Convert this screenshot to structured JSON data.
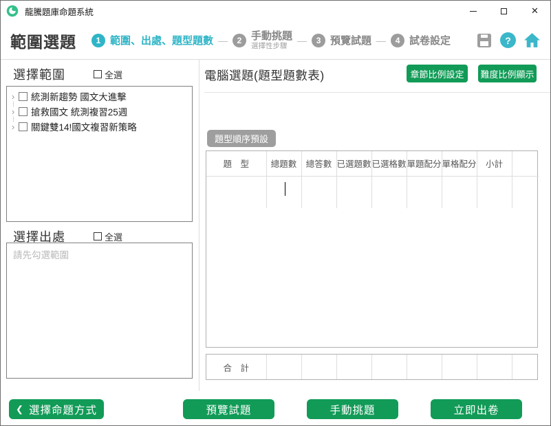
{
  "window": {
    "title": "龍騰題庫命題系統"
  },
  "titlebar_controls": {
    "close": "✕"
  },
  "header": {
    "page_title": "範圍選題",
    "separator": "—",
    "steps": [
      {
        "num": "1",
        "label": "範圍、出處、題型題數"
      },
      {
        "num": "2",
        "label": "手動挑題",
        "sublabel": "選擇性步驟"
      },
      {
        "num": "3",
        "label": "預覽試題"
      },
      {
        "num": "4",
        "label": "試卷設定"
      }
    ]
  },
  "left_panel": {
    "range_title": "選擇範圍",
    "range_select_all": "全選",
    "range_items": [
      "統測新趨勢 國文大進擊",
      "搶救國文 統測複習25週",
      "關鍵雙14!國文複習新策略"
    ],
    "source_title": "選擇出處",
    "source_select_all": "全選",
    "source_placeholder": "請先勾選範圍"
  },
  "main_panel": {
    "title": "電腦選題(題型題數表)",
    "chapter_ratio_button": "章節比例設定",
    "difficulty_ratio_button": "難度比例顯示",
    "type_order_button": "題型順序預設",
    "table_headers": [
      "題　型",
      "總題數",
      "總答數",
      "已選題數",
      "已選格數",
      "單題配分",
      "單格配分",
      "小計",
      ""
    ],
    "footer_label": "合　計"
  },
  "bottom_bar": {
    "back_arrow": "❮",
    "back_button": "選擇命題方式",
    "preview_button": "預覽試題",
    "manual_button": "手動挑題",
    "generate_button": "立即出卷"
  },
  "colors": {
    "green": "#119b57",
    "teal": "#2fb5c7",
    "step_gray": "#9c9c9c",
    "logo_green": "#34c08a"
  }
}
